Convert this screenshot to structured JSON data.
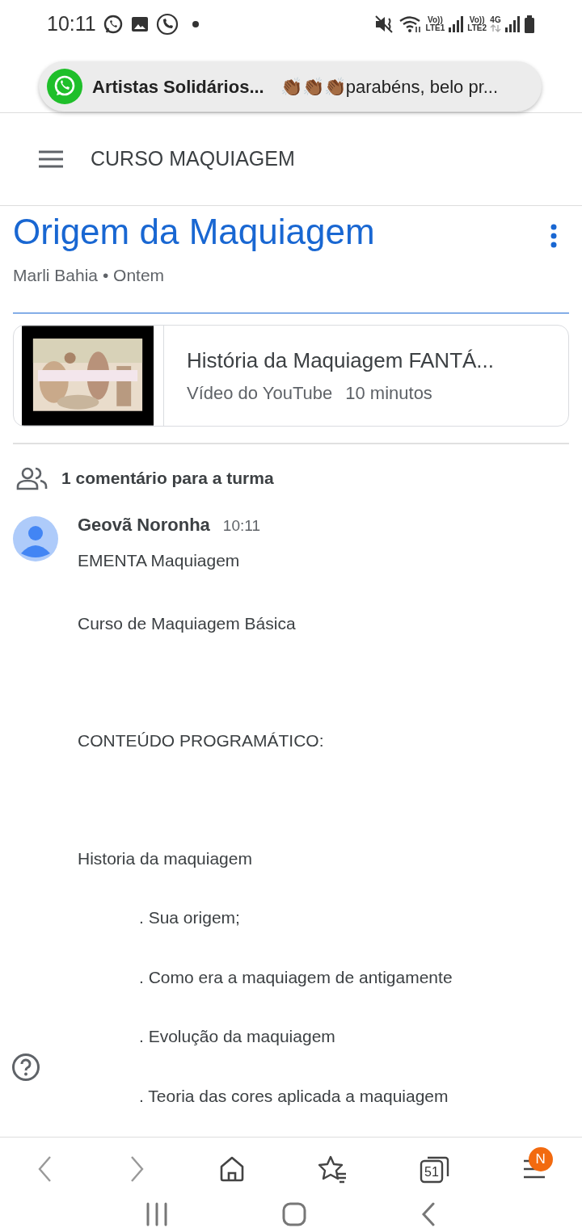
{
  "status_bar": {
    "time": "10:11",
    "sim1_label": "Vo))",
    "sim1_network": "LTE1",
    "sim2_label": "Vo))",
    "sim2_network": "LTE2",
    "data_type": "4G"
  },
  "notification": {
    "title": "Artistas Solidários...",
    "message": "👏🏾👏🏾👏🏾parabéns, belo pr..."
  },
  "app_bar": {
    "title": "CURSO MAQUIAGEM"
  },
  "post": {
    "title": "Origem da Maquiagem",
    "author": "Marli Bahia",
    "separator": "•",
    "date": "Ontem"
  },
  "attachment": {
    "kind": "picture",
    "title": "História da Maquiagem FANTÁ...",
    "source": "Vídeo do YouTube",
    "duration": "10 minutos"
  },
  "comments_header": "1 comentário para a turma",
  "comment": {
    "author": "Geovã Noronha",
    "time": "10:11",
    "lines": [
      {
        "kind": "title",
        "text": "EMENTA Maquiagem"
      },
      {
        "kind": "paragraph",
        "text": "Curso  de Maquiagem  Básica"
      },
      {
        "kind": "section",
        "text": "CONTEÚDO PROGRAMÁTICO:"
      },
      {
        "kind": "section",
        "text": "Historia da maquiagem"
      },
      {
        "kind": "item",
        "text": ". Sua origem;"
      },
      {
        "kind": "item",
        "text": ". Como era a maquiagem de antigamente"
      },
      {
        "kind": "item",
        "text": ". Evolução da maquiagem"
      },
      {
        "kind": "item",
        "text": ". Teoria das cores aplicada a maquiagem"
      }
    ]
  },
  "browser_toolbar": {
    "tab_count": "51",
    "menu_badge": "N"
  }
}
